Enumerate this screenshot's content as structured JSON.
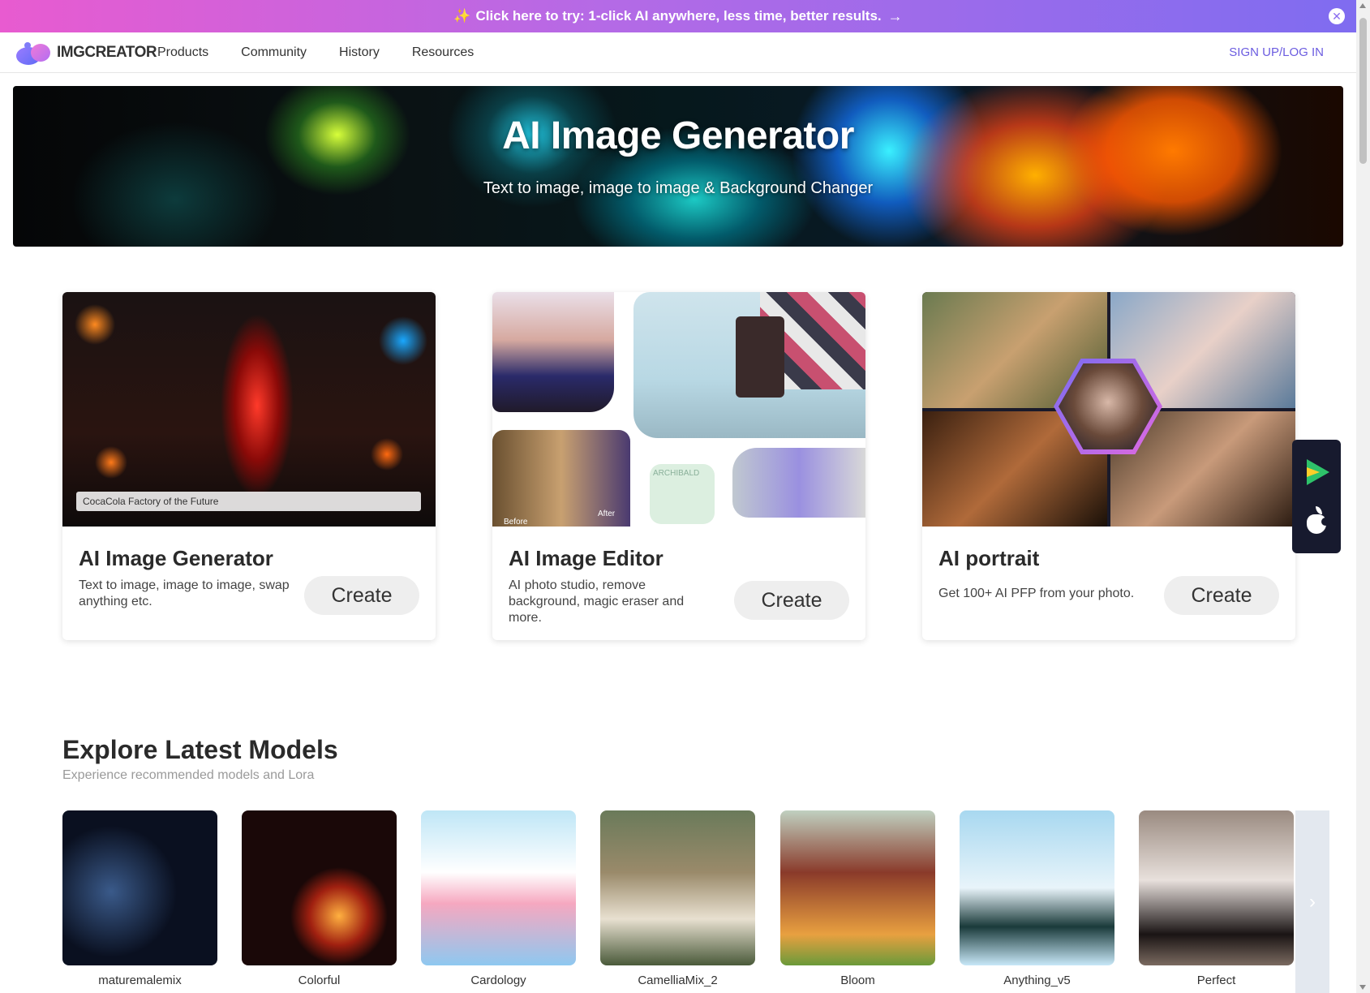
{
  "promo": {
    "sparkle_icon": "✨",
    "text": "Click here to try: 1-click AI anywhere, less time, better results.",
    "arrow_icon": "→",
    "close_icon": "✕"
  },
  "nav": {
    "logo_text": "IMGCREATOR",
    "items": [
      "Products",
      "Community",
      "History",
      "Resources"
    ],
    "auth_label": "SIGN UP/LOG IN"
  },
  "hero": {
    "title": "AI Image Generator",
    "subtitle": "Text to image, image to image & Background Changer"
  },
  "cards": [
    {
      "title": "AI Image Generator",
      "description": "Text to image, image to image, swap anything etc.",
      "button": "Create",
      "caption": "CocaCola Factory of the Future"
    },
    {
      "title": "AI Image Editor",
      "description": "AI photo studio, remove background, magic eraser and more.",
      "button": "Create",
      "tags": {
        "before": "Before",
        "after": "After",
        "brand": "ARCHIBALD"
      }
    },
    {
      "title": "AI portrait",
      "description": "Get 100+ AI PFP from your photo.",
      "button": "Create"
    }
  ],
  "explore": {
    "title": "Explore Latest Models",
    "subtitle": "Experience recommended models and Lora",
    "models": [
      "maturemalemix",
      "Colorful",
      "Cardology",
      "CamelliaMix_2",
      "Bloom",
      "Anything_v5",
      "Perfect"
    ],
    "next_icon": "›"
  },
  "colors": {
    "accent": "#6b5ce0",
    "badge_bg": "#171a2e",
    "button_bg": "#eeeeee"
  }
}
